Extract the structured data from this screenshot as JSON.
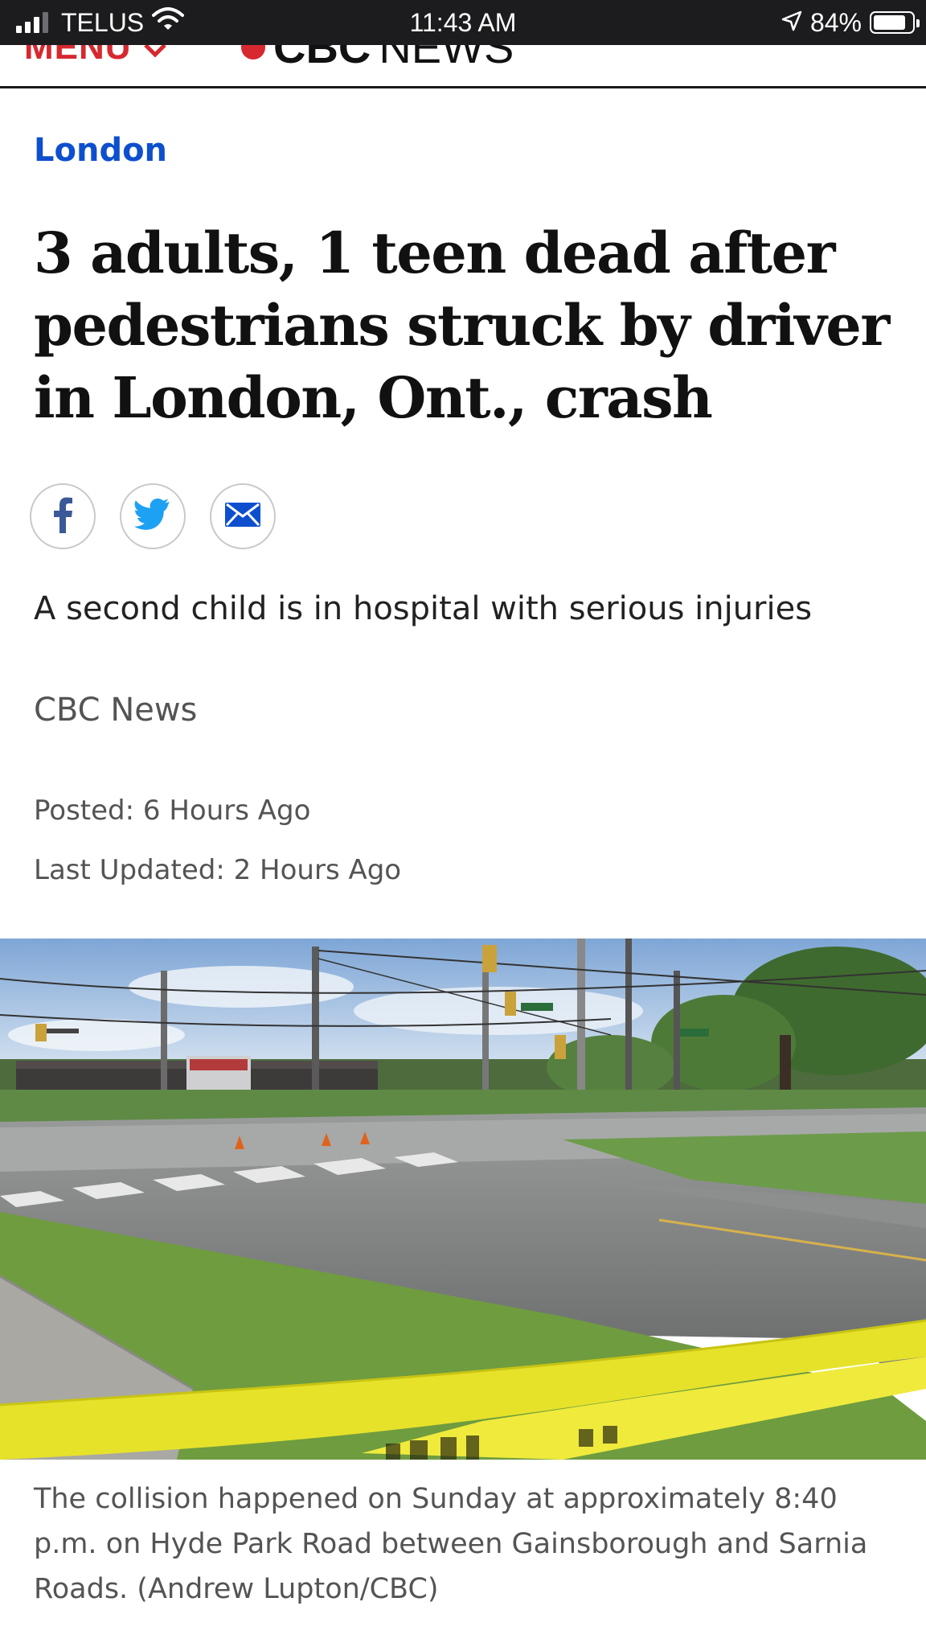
{
  "status_bar": {
    "carrier": "TELUS",
    "time": "11:43 AM",
    "battery": "84%",
    "battery_level": 0.84,
    "icons": [
      "signal-icon",
      "wifi-icon",
      "location-arrow-icon",
      "battery-icon"
    ]
  },
  "site_header": {
    "menu_label": "MENU",
    "logo_cbc": "CBC",
    "logo_news": "NEWS",
    "brand_color": "#d7282f"
  },
  "article": {
    "section": "London",
    "section_color": "#0d4fce",
    "headline": "3 adults, 1 teen dead after pedestrians struck by driver in London, Ont., crash",
    "share": {
      "icons": [
        "facebook-icon",
        "twitter-icon",
        "email-icon"
      ],
      "colors": {
        "facebook": "#3b5998",
        "twitter": "#1da1f2",
        "email": "#0d4fce"
      }
    },
    "deck": "A second child is in hospital with serious injuries",
    "byline": "CBC News",
    "posted": "Posted: 6 Hours Ago",
    "updated": "Last Updated: 2 Hours Ago",
    "photo_caption": "The collision happened on Sunday at approximately 8:40 p.m. on Hyde Park Road between Gainsborough and Sarnia Roads. (Andrew Lupton/CBC)"
  }
}
